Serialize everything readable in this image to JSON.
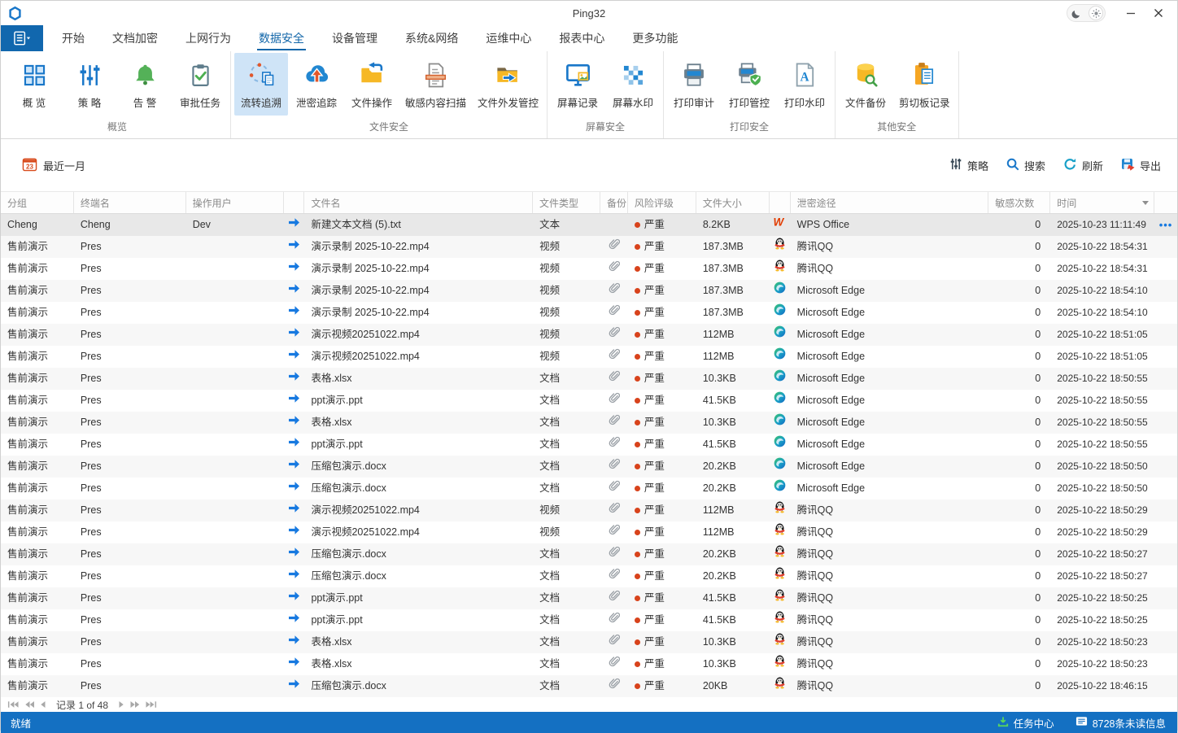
{
  "colors": {
    "accent": "#1977c9",
    "active_tab": "#1266a9",
    "statusbar_bg": "#1470c2",
    "menu_button_bg": "#1167ae",
    "ribbon_selected_bg": "#cfe4f7",
    "risk_dot": "#d8431c",
    "selected_row_bg": "#e8e8e8",
    "alt_row_bg": "#f7f7f7"
  },
  "titlebar": {
    "title": "Ping32"
  },
  "tabs": {
    "active_index": 3,
    "items": [
      {
        "id": "home",
        "label": "开始"
      },
      {
        "id": "doc-encrypt",
        "label": "文档加密"
      },
      {
        "id": "web-behavior",
        "label": "上网行为"
      },
      {
        "id": "data-security",
        "label": "数据安全"
      },
      {
        "id": "device-mgmt",
        "label": "设备管理"
      },
      {
        "id": "system-network",
        "label": "系统&网络"
      },
      {
        "id": "ops-center",
        "label": "运维中心"
      },
      {
        "id": "report-center",
        "label": "报表中心"
      },
      {
        "id": "more-features",
        "label": "更多功能"
      }
    ]
  },
  "ribbon": {
    "groups": [
      {
        "id": "overview-group",
        "label": "概览",
        "buttons": [
          {
            "id": "overview",
            "label": "概 览",
            "icon": "overview",
            "selected": false
          },
          {
            "id": "policy",
            "label": "策 略",
            "icon": "policy",
            "selected": false
          },
          {
            "id": "alert",
            "label": "告 警",
            "icon": "alert",
            "selected": false
          },
          {
            "id": "approval-tasks",
            "label": "审批任务",
            "icon": "approve",
            "selected": false
          }
        ]
      },
      {
        "id": "file-security-group",
        "label": "文件安全",
        "buttons": [
          {
            "id": "flow-trace",
            "label": "流转追溯",
            "icon": "trace",
            "selected": true
          },
          {
            "id": "leak-trace",
            "label": "泄密追踪",
            "icon": "leak",
            "selected": false
          },
          {
            "id": "file-operations",
            "label": "文件操作",
            "icon": "fileop",
            "selected": false
          },
          {
            "id": "sensitive-scan",
            "label": "敏感内容扫描",
            "icon": "scan",
            "selected": false
          },
          {
            "id": "file-outgoing-control",
            "label": "文件外发管控",
            "icon": "outsend",
            "selected": false
          }
        ]
      },
      {
        "id": "screen-security-group",
        "label": "屏幕安全",
        "buttons": [
          {
            "id": "screen-record",
            "label": "屏幕记录",
            "icon": "screenrec",
            "selected": false
          },
          {
            "id": "screen-watermark",
            "label": "屏幕水印",
            "icon": "watermark",
            "selected": false
          }
        ]
      },
      {
        "id": "print-security-group",
        "label": "打印安全",
        "buttons": [
          {
            "id": "print-audit",
            "label": "打印审计",
            "icon": "print",
            "selected": false
          },
          {
            "id": "print-control",
            "label": "打印管控",
            "icon": "printctl",
            "selected": false
          },
          {
            "id": "print-watermark",
            "label": "打印水印",
            "icon": "printwm",
            "selected": false
          }
        ]
      },
      {
        "id": "other-security-group",
        "label": "其他安全",
        "buttons": [
          {
            "id": "file-backup",
            "label": "文件备份",
            "icon": "backup",
            "selected": false
          },
          {
            "id": "clipboard-record",
            "label": "剪切板记录",
            "icon": "clipboard",
            "selected": false
          }
        ]
      }
    ]
  },
  "filterbar": {
    "date_label": "最近一月",
    "actions": [
      {
        "id": "policy-action",
        "label": "策略",
        "icon": "sliders"
      },
      {
        "id": "search-action",
        "label": "搜索",
        "icon": "search"
      },
      {
        "id": "refresh-action",
        "label": "刷新",
        "icon": "refresh"
      },
      {
        "id": "export-action",
        "label": "导出",
        "icon": "export"
      }
    ]
  },
  "table": {
    "columns": [
      {
        "id": "group",
        "label": "分组"
      },
      {
        "id": "terminal",
        "label": "终端名"
      },
      {
        "id": "operator",
        "label": "操作用户"
      },
      {
        "id": "arrow",
        "label": ""
      },
      {
        "id": "filename",
        "label": "文件名"
      },
      {
        "id": "filetype",
        "label": "文件类型"
      },
      {
        "id": "backup",
        "label": "备份"
      },
      {
        "id": "risk",
        "label": "风险评级"
      },
      {
        "id": "filesize",
        "label": "文件大小"
      },
      {
        "id": "appicon",
        "label": ""
      },
      {
        "id": "channel",
        "label": "泄密途径"
      },
      {
        "id": "count",
        "label": "敏感次数"
      },
      {
        "id": "time",
        "label": "时间",
        "sort": true
      },
      {
        "id": "menu",
        "label": ""
      }
    ],
    "rows": [
      {
        "group": "Cheng",
        "terminal": "Cheng",
        "user": "Dev",
        "file": "新建文本文档 (5).txt",
        "type": "文本",
        "backup": false,
        "risk": "严重",
        "size": "8.2KB",
        "app": "WPS Office",
        "app_icon": "wps",
        "count": "0",
        "time": "2025-10-23 11:11:49",
        "selected": true,
        "menu": true
      },
      {
        "group": "售前演示",
        "terminal": "Pres",
        "user": "",
        "file": "演示录制 2025-10-22.mp4",
        "type": "视频",
        "backup": true,
        "risk": "严重",
        "size": "187.3MB",
        "app": "腾讯QQ",
        "app_icon": "qq",
        "count": "0",
        "time": "2025-10-22 18:54:31",
        "selected": false,
        "menu": false
      },
      {
        "group": "售前演示",
        "terminal": "Pres",
        "user": "",
        "file": "演示录制 2025-10-22.mp4",
        "type": "视频",
        "backup": true,
        "risk": "严重",
        "size": "187.3MB",
        "app": "腾讯QQ",
        "app_icon": "qq",
        "count": "0",
        "time": "2025-10-22 18:54:31",
        "selected": false,
        "menu": false
      },
      {
        "group": "售前演示",
        "terminal": "Pres",
        "user": "",
        "file": "演示录制 2025-10-22.mp4",
        "type": "视频",
        "backup": true,
        "risk": "严重",
        "size": "187.3MB",
        "app": "Microsoft Edge",
        "app_icon": "edge",
        "count": "0",
        "time": "2025-10-22 18:54:10",
        "selected": false,
        "menu": false
      },
      {
        "group": "售前演示",
        "terminal": "Pres",
        "user": "",
        "file": "演示录制 2025-10-22.mp4",
        "type": "视频",
        "backup": true,
        "risk": "严重",
        "size": "187.3MB",
        "app": "Microsoft Edge",
        "app_icon": "edge",
        "count": "0",
        "time": "2025-10-22 18:54:10",
        "selected": false,
        "menu": false
      },
      {
        "group": "售前演示",
        "terminal": "Pres",
        "user": "",
        "file": "演示视频20251022.mp4",
        "type": "视频",
        "backup": true,
        "risk": "严重",
        "size": "112MB",
        "app": "Microsoft Edge",
        "app_icon": "edge",
        "count": "0",
        "time": "2025-10-22 18:51:05",
        "selected": false,
        "menu": false
      },
      {
        "group": "售前演示",
        "terminal": "Pres",
        "user": "",
        "file": "演示视频20251022.mp4",
        "type": "视频",
        "backup": true,
        "risk": "严重",
        "size": "112MB",
        "app": "Microsoft Edge",
        "app_icon": "edge",
        "count": "0",
        "time": "2025-10-22 18:51:05",
        "selected": false,
        "menu": false
      },
      {
        "group": "售前演示",
        "terminal": "Pres",
        "user": "",
        "file": "表格.xlsx",
        "type": "文档",
        "backup": true,
        "risk": "严重",
        "size": "10.3KB",
        "app": "Microsoft Edge",
        "app_icon": "edge",
        "count": "0",
        "time": "2025-10-22 18:50:55",
        "selected": false,
        "menu": false
      },
      {
        "group": "售前演示",
        "terminal": "Pres",
        "user": "",
        "file": "ppt演示.ppt",
        "type": "文档",
        "backup": true,
        "risk": "严重",
        "size": "41.5KB",
        "app": "Microsoft Edge",
        "app_icon": "edge",
        "count": "0",
        "time": "2025-10-22 18:50:55",
        "selected": false,
        "menu": false
      },
      {
        "group": "售前演示",
        "terminal": "Pres",
        "user": "",
        "file": "表格.xlsx",
        "type": "文档",
        "backup": true,
        "risk": "严重",
        "size": "10.3KB",
        "app": "Microsoft Edge",
        "app_icon": "edge",
        "count": "0",
        "time": "2025-10-22 18:50:55",
        "selected": false,
        "menu": false
      },
      {
        "group": "售前演示",
        "terminal": "Pres",
        "user": "",
        "file": "ppt演示.ppt",
        "type": "文档",
        "backup": true,
        "risk": "严重",
        "size": "41.5KB",
        "app": "Microsoft Edge",
        "app_icon": "edge",
        "count": "0",
        "time": "2025-10-22 18:50:55",
        "selected": false,
        "menu": false
      },
      {
        "group": "售前演示",
        "terminal": "Pres",
        "user": "",
        "file": "压缩包演示.docx",
        "type": "文档",
        "backup": true,
        "risk": "严重",
        "size": "20.2KB",
        "app": "Microsoft Edge",
        "app_icon": "edge",
        "count": "0",
        "time": "2025-10-22 18:50:50",
        "selected": false,
        "menu": false
      },
      {
        "group": "售前演示",
        "terminal": "Pres",
        "user": "",
        "file": "压缩包演示.docx",
        "type": "文档",
        "backup": true,
        "risk": "严重",
        "size": "20.2KB",
        "app": "Microsoft Edge",
        "app_icon": "edge",
        "count": "0",
        "time": "2025-10-22 18:50:50",
        "selected": false,
        "menu": false
      },
      {
        "group": "售前演示",
        "terminal": "Pres",
        "user": "",
        "file": "演示视频20251022.mp4",
        "type": "视频",
        "backup": true,
        "risk": "严重",
        "size": "112MB",
        "app": "腾讯QQ",
        "app_icon": "qq",
        "count": "0",
        "time": "2025-10-22 18:50:29",
        "selected": false,
        "menu": false
      },
      {
        "group": "售前演示",
        "terminal": "Pres",
        "user": "",
        "file": "演示视频20251022.mp4",
        "type": "视频",
        "backup": true,
        "risk": "严重",
        "size": "112MB",
        "app": "腾讯QQ",
        "app_icon": "qq",
        "count": "0",
        "time": "2025-10-22 18:50:29",
        "selected": false,
        "menu": false
      },
      {
        "group": "售前演示",
        "terminal": "Pres",
        "user": "",
        "file": "压缩包演示.docx",
        "type": "文档",
        "backup": true,
        "risk": "严重",
        "size": "20.2KB",
        "app": "腾讯QQ",
        "app_icon": "qq",
        "count": "0",
        "time": "2025-10-22 18:50:27",
        "selected": false,
        "menu": false
      },
      {
        "group": "售前演示",
        "terminal": "Pres",
        "user": "",
        "file": "压缩包演示.docx",
        "type": "文档",
        "backup": true,
        "risk": "严重",
        "size": "20.2KB",
        "app": "腾讯QQ",
        "app_icon": "qq",
        "count": "0",
        "time": "2025-10-22 18:50:27",
        "selected": false,
        "menu": false
      },
      {
        "group": "售前演示",
        "terminal": "Pres",
        "user": "",
        "file": "ppt演示.ppt",
        "type": "文档",
        "backup": true,
        "risk": "严重",
        "size": "41.5KB",
        "app": "腾讯QQ",
        "app_icon": "qq",
        "count": "0",
        "time": "2025-10-22 18:50:25",
        "selected": false,
        "menu": false
      },
      {
        "group": "售前演示",
        "terminal": "Pres",
        "user": "",
        "file": "ppt演示.ppt",
        "type": "文档",
        "backup": true,
        "risk": "严重",
        "size": "41.5KB",
        "app": "腾讯QQ",
        "app_icon": "qq",
        "count": "0",
        "time": "2025-10-22 18:50:25",
        "selected": false,
        "menu": false
      },
      {
        "group": "售前演示",
        "terminal": "Pres",
        "user": "",
        "file": "表格.xlsx",
        "type": "文档",
        "backup": true,
        "risk": "严重",
        "size": "10.3KB",
        "app": "腾讯QQ",
        "app_icon": "qq",
        "count": "0",
        "time": "2025-10-22 18:50:23",
        "selected": false,
        "menu": false
      },
      {
        "group": "售前演示",
        "terminal": "Pres",
        "user": "",
        "file": "表格.xlsx",
        "type": "文档",
        "backup": true,
        "risk": "严重",
        "size": "10.3KB",
        "app": "腾讯QQ",
        "app_icon": "qq",
        "count": "0",
        "time": "2025-10-22 18:50:23",
        "selected": false,
        "menu": false
      },
      {
        "group": "售前演示",
        "terminal": "Pres",
        "user": "",
        "file": "压缩包演示.docx",
        "type": "文档",
        "backup": true,
        "risk": "严重",
        "size": "20KB",
        "app": "腾讯QQ",
        "app_icon": "qq",
        "count": "0",
        "time": "2025-10-22 18:46:15",
        "selected": false,
        "menu": false
      }
    ]
  },
  "pagination": {
    "record_text": "记录 1 of 48"
  },
  "statusbar": {
    "ready": "就绪",
    "task_label": "任务中心",
    "unread_label": "8728条未读信息"
  }
}
